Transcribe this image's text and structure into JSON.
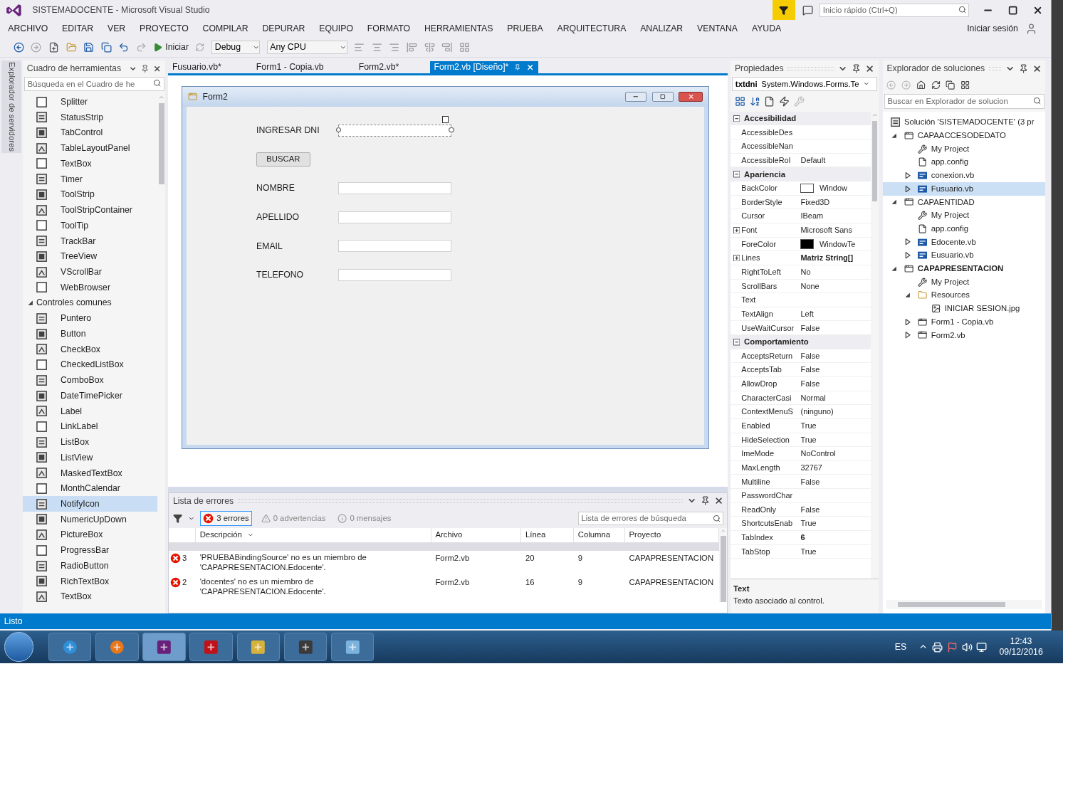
{
  "window": {
    "title": "SISTEMADOCENTE - Microsoft Visual Studio"
  },
  "title_bar": {
    "quick_launch": {
      "placeholder": "Inicio rápido (Ctrl+Q)"
    }
  },
  "menu": {
    "items": [
      "ARCHIVO",
      "EDITAR",
      "VER",
      "PROYECTO",
      "COMPILAR",
      "DEPURAR",
      "EQUIPO",
      "FORMATO",
      "HERRAMIENTAS",
      "PRUEBA",
      "ARQUITECTURA",
      "ANALIZAR",
      "VENTANA",
      "AYUDA"
    ],
    "sign_in": "Iniciar sesión"
  },
  "toolbar": {
    "start": "Iniciar",
    "configuration": "Debug",
    "platform": "Any CPU"
  },
  "left_strip": {
    "label": "Explorador de servidores"
  },
  "toolbox": {
    "title": "Cuadro de herramientas",
    "search": {
      "placeholder": "Búsqueda en el Cuadro de he"
    },
    "items": [
      {
        "label": "Splitter",
        "selected": false
      },
      {
        "label": "StatusStrip",
        "selected": false
      },
      {
        "label": "TabControl",
        "selected": false
      },
      {
        "label": "TableLayoutPanel",
        "selected": false
      },
      {
        "label": "TextBox",
        "selected": false
      },
      {
        "label": "Timer",
        "selected": false
      },
      {
        "label": "ToolStrip",
        "selected": false
      },
      {
        "label": "ToolStripContainer",
        "selected": false
      },
      {
        "label": "ToolTip",
        "selected": false
      },
      {
        "label": "TrackBar",
        "selected": false
      },
      {
        "label": "TreeView",
        "selected": false
      },
      {
        "label": "VScrollBar",
        "selected": false
      },
      {
        "label": "WebBrowser",
        "selected": false
      }
    ],
    "group": {
      "label": "Controles comunes",
      "expanded": true,
      "items": [
        {
          "label": "Puntero",
          "selected": false
        },
        {
          "label": "Button",
          "selected": false
        },
        {
          "label": "CheckBox",
          "selected": false
        },
        {
          "label": "CheckedListBox",
          "selected": false
        },
        {
          "label": "ComboBox",
          "selected": false
        },
        {
          "label": "DateTimePicker",
          "selected": false
        },
        {
          "label": "Label",
          "selected": false
        },
        {
          "label": "LinkLabel",
          "selected": false
        },
        {
          "label": "ListBox",
          "selected": false
        },
        {
          "label": "ListView",
          "selected": false
        },
        {
          "label": "MaskedTextBox",
          "selected": false
        },
        {
          "label": "MonthCalendar",
          "selected": false
        },
        {
          "label": "NotifyIcon",
          "selected": true
        },
        {
          "label": "NumericUpDown",
          "selected": false
        },
        {
          "label": "PictureBox",
          "selected": false
        },
        {
          "label": "ProgressBar",
          "selected": false
        },
        {
          "label": "RadioButton",
          "selected": false
        },
        {
          "label": "RichTextBox",
          "selected": false
        },
        {
          "label": "TextBox",
          "selected": false
        }
      ]
    }
  },
  "document_tabs": [
    {
      "label": "Fusuario.vb*",
      "selected": false
    },
    {
      "label": "Form1 - Copia.vb",
      "selected": false
    },
    {
      "label": "Form2.vb*",
      "selected": false
    },
    {
      "label": "Form2.vb [Diseño]*",
      "selected": true
    }
  ],
  "form": {
    "title": "Form2",
    "controls": [
      {
        "kind": "field",
        "label": "INGRESAR DNI",
        "selected": true
      },
      {
        "kind": "button",
        "label": "BUSCAR",
        "selected": false
      },
      {
        "kind": "field",
        "label": "NOMBRE",
        "selected": false
      },
      {
        "kind": "field",
        "label": "APELLIDO",
        "selected": false
      },
      {
        "kind": "field",
        "label": "EMAIL",
        "selected": false
      },
      {
        "kind": "field",
        "label": "TELEFONO",
        "selected": false
      }
    ]
  },
  "error_list": {
    "title": "Lista de errores",
    "filters": [
      {
        "kind": "error",
        "label": "3 errores",
        "selected": true
      },
      {
        "kind": "warning",
        "label": "0 advertencias",
        "selected": false
      },
      {
        "kind": "message",
        "label": "0 mensajes",
        "selected": false
      }
    ],
    "search": {
      "placeholder": "Lista de errores de búsqueda"
    },
    "columns": [
      "Descripción",
      "Archivo",
      "Línea",
      "Columna",
      "Proyecto"
    ],
    "rows": [
      {
        "number": "3",
        "description": "'PRUEBABindingSource' no es un miembro de 'CAPAPRESENTACION.Edocente'.",
        "file": "Form2.vb",
        "line": "20",
        "column": "9",
        "project": "CAPAPRESENTACION"
      },
      {
        "number": "2",
        "description": "'docentes' no es un miembro de 'CAPAPRESENTACION.Edocente'.",
        "file": "Form2.vb",
        "line": "16",
        "column": "9",
        "project": "CAPAPRESENTACION"
      }
    ]
  },
  "properties": {
    "title": "Propiedades",
    "object": "txtdni",
    "type": "System.Windows.Forms.Te",
    "categories": [
      {
        "name": "Accesibilidad",
        "expanded": true,
        "rows": [
          {
            "kind": "text",
            "name": "AccessibleDes"
          },
          {
            "kind": "text",
            "name": "AccessibleNan"
          },
          {
            "kind": "text",
            "name": "AccessibleRol",
            "value": "Default"
          }
        ]
      },
      {
        "name": "Apariencia",
        "expanded": true,
        "rows": [
          {
            "kind": "color",
            "name": "BackColor",
            "value": "Window",
            "color": "#ffffff"
          },
          {
            "kind": "text",
            "name": "BorderStyle",
            "value": "Fixed3D"
          },
          {
            "kind": "text",
            "name": "Cursor",
            "value": "IBeam"
          },
          {
            "kind": "expandable",
            "name": "Font",
            "value": "Microsoft Sans"
          },
          {
            "kind": "color",
            "name": "ForeColor",
            "value": "WindowTe",
            "color": "#000000"
          },
          {
            "kind": "expandable",
            "name": "Lines",
            "value": "Matriz String[]",
            "modified": true
          },
          {
            "kind": "text",
            "name": "RightToLeft",
            "value": "No"
          },
          {
            "kind": "text",
            "name": "ScrollBars",
            "value": "None"
          },
          {
            "kind": "text",
            "name": "Text"
          },
          {
            "kind": "text",
            "name": "TextAlign",
            "value": "Left"
          },
          {
            "kind": "text",
            "name": "UseWaitCursor",
            "value": "False"
          }
        ]
      },
      {
        "name": "Comportamiento",
        "expanded": true,
        "rows": [
          {
            "kind": "text",
            "name": "AcceptsReturn",
            "value": "False"
          },
          {
            "kind": "text",
            "name": "AcceptsTab",
            "value": "False"
          },
          {
            "kind": "text",
            "name": "AllowDrop",
            "value": "False"
          },
          {
            "kind": "text",
            "name": "CharacterCasi",
            "value": "Normal"
          },
          {
            "kind": "text",
            "name": "ContextMenuS",
            "value": "(ninguno)"
          },
          {
            "kind": "text",
            "name": "Enabled",
            "value": "True"
          },
          {
            "kind": "text",
            "name": "HideSelection",
            "value": "True"
          },
          {
            "kind": "text",
            "name": "ImeMode",
            "value": "NoControl"
          },
          {
            "kind": "text",
            "name": "MaxLength",
            "value": "32767"
          },
          {
            "kind": "text",
            "name": "Multiline",
            "value": "False"
          },
          {
            "kind": "text",
            "name": "PasswordChar"
          },
          {
            "kind": "text",
            "name": "ReadOnly",
            "value": "False"
          },
          {
            "kind": "text",
            "name": "ShortcutsEnab",
            "value": "True"
          },
          {
            "kind": "text",
            "name": "TabIndex",
            "value": "6",
            "modified": true
          },
          {
            "kind": "text",
            "name": "TabStop",
            "value": "True"
          }
        ]
      }
    ],
    "description": {
      "name": "Text",
      "text": "Texto asociado al control."
    }
  },
  "solution_explorer": {
    "title": "Explorador de soluciones",
    "search": {
      "placeholder": "Buscar en Explorador de solucion"
    },
    "tree": [
      {
        "label": "Solución 'SISTEMADOCENTE' (3 pr",
        "kind": "solution",
        "selected": false,
        "children": [
          {
            "label": "CAPAACCESODEDATO",
            "kind": "project",
            "expanded": true,
            "startup": false,
            "selected": false,
            "children": [
              {
                "label": "My Project",
                "kind": "myproject",
                "selected": false
              },
              {
                "label": "app.config",
                "kind": "config",
                "selected": false
              },
              {
                "label": "conexion.vb",
                "kind": "vb",
                "expanded": false,
                "selected": false
              },
              {
                "label": "Fusuario.vb",
                "kind": "vb",
                "expanded": false,
                "selected": true
              }
            ]
          },
          {
            "label": "CAPAENTIDAD",
            "kind": "project",
            "expanded": true,
            "startup": false,
            "selected": false,
            "children": [
              {
                "label": "My Project",
                "kind": "myproject",
                "selected": false
              },
              {
                "label": "app.config",
                "kind": "config",
                "selected": false
              },
              {
                "label": "Edocente.vb",
                "kind": "vb",
                "expanded": false,
                "selected": false
              },
              {
                "label": "Eusuario.vb",
                "kind": "vb",
                "expanded": false,
                "selected": false
              }
            ]
          },
          {
            "label": "CAPAPRESENTACION",
            "kind": "project",
            "expanded": true,
            "startup": true,
            "selected": false,
            "children": [
              {
                "label": "My Project",
                "kind": "myproject",
                "selected": false
              },
              {
                "label": "Resources",
                "kind": "folder",
                "expanded": true,
                "selected": false,
                "children": [
                  {
                    "label": "INICIAR SESION.jpg",
                    "kind": "image",
                    "selected": false
                  }
                ]
              },
              {
                "label": "Form1 - Copia.vb",
                "kind": "form",
                "expanded": false,
                "selected": false
              },
              {
                "label": "Form2.vb",
                "kind": "form",
                "expanded": false,
                "selected": false
              }
            ]
          }
        ]
      }
    ]
  },
  "status_bar": {
    "text": "Listo"
  },
  "taskbar": {
    "language": "ES",
    "time": "12:43",
    "date": "09/12/2016"
  }
}
